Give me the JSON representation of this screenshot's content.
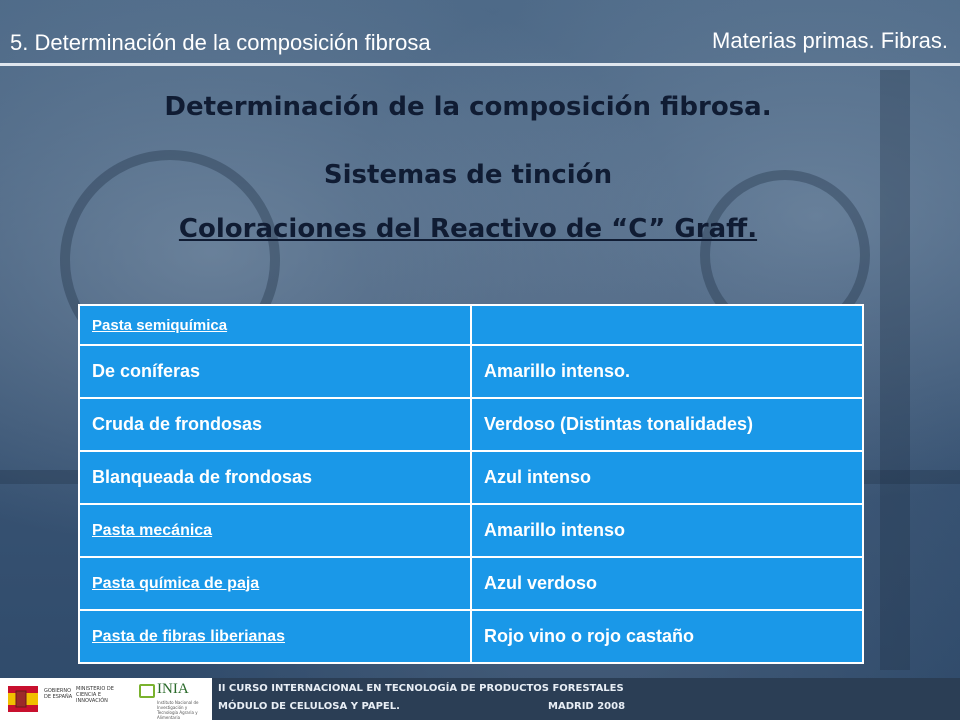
{
  "header": {
    "section": "5. Determinación de la composición fibrosa",
    "topic": "Materias primas. Fibras."
  },
  "titles": {
    "main": "Determinación de la composición fibrosa.",
    "sub": "Sistemas de tinción",
    "sub2": "Coloraciones del  Reactivo de “C” Graff."
  },
  "table": {
    "rows": [
      {
        "col1": "Pasta semiquímica",
        "col2": ""
      },
      {
        "col1": "De coníferas",
        "col2": "Amarillo intenso."
      },
      {
        "col1": "Cruda de frondosas",
        "col2": "Verdoso (Distintas tonalidades)"
      },
      {
        "col1": "Blanqueada de frondosas",
        "col2": "Azul intenso"
      },
      {
        "col1": "Pasta mecánica",
        "col2": "Amarillo intenso"
      },
      {
        "col1": "Pasta química de paja",
        "col2": "Azul verdoso"
      },
      {
        "col1": "Pasta de fibras liberianas",
        "col2": "Rojo vino o rojo castaño"
      }
    ]
  },
  "footer": {
    "spain_logo_text": "GOBIERNO DE ESPAÑA",
    "ministry_text": "MINISTERIO DE CIENCIA E INNOVACIÓN",
    "inia_logo": "INIA",
    "inia_subtext": "Instituto Nacional de Investigación y Tecnología Agraria y Alimentaria",
    "line1": "II CURSO INTERNACIONAL EN TECNOLOGÍA DE PRODUCTOS FORESTALES",
    "line2": "MÓDULO DE CELULOSA Y PAPEL.",
    "line3": "MADRID 2008"
  },
  "colors": {
    "table_bg": "#1a98e8",
    "title_color": "#101c33",
    "footer_dark": "#2b3e55"
  }
}
